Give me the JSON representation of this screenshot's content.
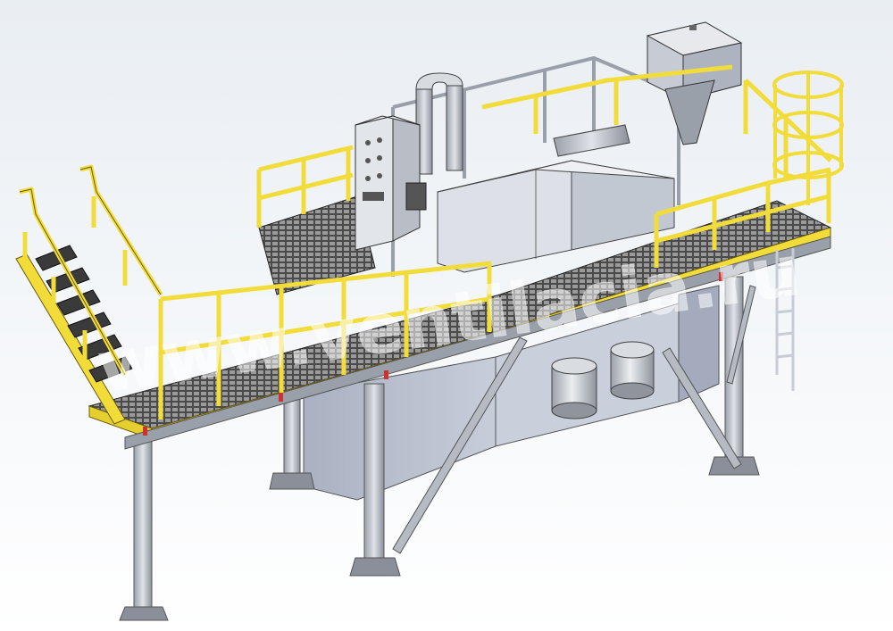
{
  "watermark": {
    "text": "www.ventilacia.ru"
  },
  "colors": {
    "background_top": "#e9eef3",
    "background_bottom": "#ffffff",
    "railing": "#f2dc3a",
    "railing_edge": "#6b5c08",
    "grating": "#3a3a3a",
    "steel": "#c8ccd4",
    "steel_dark": "#8a8f99",
    "tank": "#b8c0d0",
    "cabinet": "#d7dbe2",
    "red_marker": "#d03030",
    "watermark": "#ffffff"
  },
  "components": [
    {
      "name": "access-stairs",
      "icon": "stairs-icon"
    },
    {
      "name": "main-platform",
      "icon": "grating-icon"
    },
    {
      "name": "control-cabinet",
      "icon": "cabinet-icon"
    },
    {
      "name": "treatment-unit",
      "icon": "tank-icon"
    },
    {
      "name": "dosing-hopper",
      "icon": "hopper-icon"
    },
    {
      "name": "cage-ladder",
      "icon": "ladder-icon"
    },
    {
      "name": "drums",
      "icon": "drum-icon"
    },
    {
      "name": "support-columns",
      "icon": "column-icon"
    }
  ]
}
